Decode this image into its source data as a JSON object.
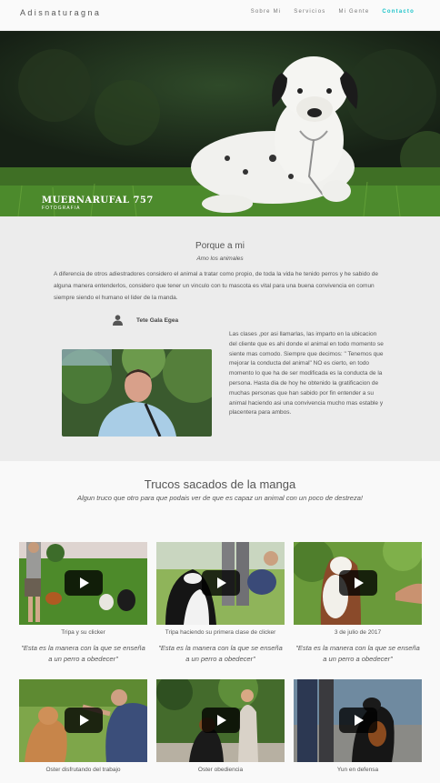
{
  "header": {
    "brand": "Adisnaturagna",
    "nav": [
      "Sobre Mi",
      "Servicios",
      "Mi Gente",
      "Contacto"
    ],
    "active_index": 3
  },
  "hero": {
    "logo_line1": "MUERNARUFAL 757",
    "logo_line2": "FOTOGRAFIA",
    "slide_count": 3,
    "active_slide": 1
  },
  "about": {
    "title": "Porque a mi",
    "subtitle": "Amo los animales",
    "intro": "A diferencia de otros adiestradores considero el animal a tratar como propio, de toda la vida he tenido perros y he sabido de alguna manera entenderlos, considero que tener un vinculo con tu mascota es vital para una buena convivencia en comun siempre siendo el humano el lider de la manda.",
    "person_name": "Tete Gala Egea",
    "bio": "Las clases ,por asi llamarlas, las imparto en la ubicacion del cliente que es ahi donde el animal en todo momento se siente mas comodo. Siempre que decimos: \" Tenemos que mejorar la conducta del animal\" NO es cierto, en todo momento lo que ha de ser modificada es la conducta de la persona. Hasta dia de hoy he obtenido la gratificacion de muchas personas que han sabido por fin entender a su animal haciendo asi una convivencia mucho mas estable y placentera para ambos."
  },
  "tricks": {
    "title": "Trucos sacados de la manga",
    "subtitle": "Algun truco que otro para que podais ver de que es capaz un animal con un poco de destreza!",
    "videos": [
      {
        "caption": "Tripa y su clicker",
        "quote": "\"Esta es la manera con la que se enseña a un perro a obedecer\""
      },
      {
        "caption": "Tripa haciendo su primera clase de clicker",
        "quote": "\"Esta es la manera con la que se enseña a un perro a obedecer\""
      },
      {
        "caption": "3 de julio de 2017",
        "quote": "\"Esta es la manera con la que se enseña a un perro a obedecer\""
      },
      {
        "caption": "Oster disfrutando del trabajo",
        "quote": ""
      },
      {
        "caption": "Oster obediencia",
        "quote": ""
      },
      {
        "caption": "Yun en defensa",
        "quote": ""
      }
    ]
  },
  "colors": {
    "accent": "#19c3c9",
    "about_bg": "#ececec",
    "tricks_bg": "#f9f9f9"
  }
}
